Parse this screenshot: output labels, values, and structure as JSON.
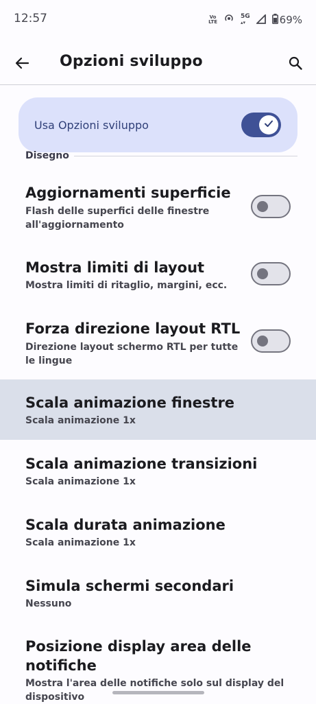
{
  "status_bar": {
    "time": "12:57",
    "volte_top": "Vo",
    "volte_bottom": "LTE",
    "network": "5G",
    "battery": "69%",
    "icons": [
      "volte-icon",
      "hotspot-icon",
      "5g-signal-icon",
      "signal-icon",
      "battery-icon"
    ]
  },
  "app_bar": {
    "title": "Opzioni sviluppo",
    "back_icon": "arrow-back-icon",
    "search_icon": "search-icon"
  },
  "master_toggle": {
    "label": "Usa Opzioni sviluppo",
    "state": "on"
  },
  "section": {
    "title": "Disegno"
  },
  "settings": [
    {
      "title": "Aggiornamenti superficie",
      "subtitle": "Flash delle superfici delle finestre all'aggiornamento",
      "toggle": "off"
    },
    {
      "title": "Mostra limiti di layout",
      "subtitle": "Mostra limiti di ritaglio, margini, ecc.",
      "toggle": "off"
    },
    {
      "title": "Forza direzione layout RTL",
      "subtitle": "Direzione layout schermo RTL per tutte le lingue",
      "toggle": "off"
    },
    {
      "title": "Scala animazione finestre",
      "subtitle": "Scala animazione 1x",
      "highlighted": true
    },
    {
      "title": "Scala animazione transizioni",
      "subtitle": "Scala animazione 1x"
    },
    {
      "title": "Scala durata animazione",
      "subtitle": "Scala animazione 1x"
    },
    {
      "title": "Simula schermi secondari",
      "subtitle": "Nessuno"
    },
    {
      "title": "Posizione display area delle notifiche",
      "subtitle": "Mostra l'area delle notifiche solo sul display del dispositivo"
    }
  ],
  "colors": {
    "background": "#fdfcff",
    "card": "#dce1fb",
    "accent": "#3f5196",
    "highlight": "#dadfea"
  }
}
